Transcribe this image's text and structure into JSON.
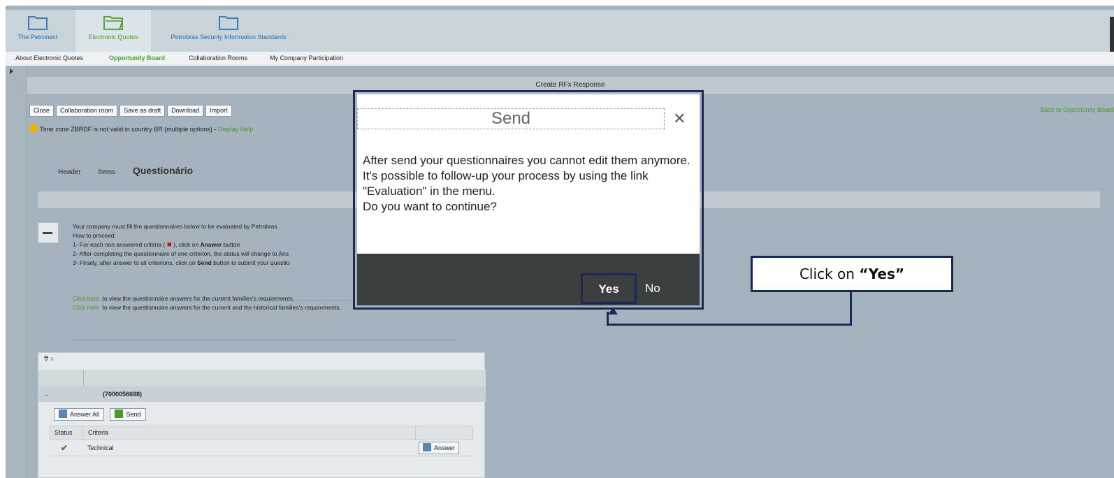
{
  "topnav": {
    "tabs": [
      {
        "label": "The Petronect",
        "active": false
      },
      {
        "label": "Electronic Quotes",
        "active": true
      },
      {
        "label": "Petrobras Security Information Standards",
        "active": false
      }
    ]
  },
  "subnav": {
    "items": [
      {
        "label": "About Electronic Quotes",
        "active": false
      },
      {
        "label": "Opportunity Board",
        "active": true
      },
      {
        "label": "Collaboration Rooms",
        "active": false
      },
      {
        "label": "My Company Participation",
        "active": false
      }
    ]
  },
  "page": {
    "title": "Create RFx Response",
    "toolbar": [
      "Close",
      "Collaboration room",
      "Save as draft",
      "Download",
      "Import"
    ],
    "back_link": "Back to Opportunity Board",
    "warning_text": "Time zone ZBRDF is not valid in country BR (multiple options) - ",
    "warning_link": "Display Help",
    "tabs": [
      "Header",
      "Items",
      "Questionário"
    ],
    "instructions": {
      "line1": "Your company must fill the questionnaires below to be evaluated by Petrobras.",
      "line2": "How to proceed:",
      "line3a": "1- For each non answered criteria (",
      "line3b": "), click on",
      "line3c": "Answer",
      "line3d": "button",
      "line4": "2- After completing the questionnaire of one criterion, the status will change to Ans",
      "line5a": "3- Finally, after answer to all criterions, click on",
      "line5b": "Send",
      "line5c": "button to submit your questio",
      "click_here": "Click here",
      "link1_text": "to view the questionnaire answers for the current families's requirements.",
      "link2_text": "to view the questionnaire answers for the current and the historical families's requirements."
    },
    "grid": {
      "group_id": "(7000056688)",
      "answer_all": "Answer All",
      "send": "Send",
      "col_status": "Status",
      "col_criteria": "Criteria",
      "row_criteria": "Technical",
      "row_answer": "Answer"
    }
  },
  "dialog": {
    "title": "Send",
    "line1": "After send your questionnaires you cannot edit them anymore.",
    "line2": "It's possible to follow-up your process by using the link \"Evaluation\" in the menu.",
    "line3": "Do you want to continue?",
    "yes": "Yes",
    "no": "No"
  },
  "callout": {
    "prefix": "Click on ",
    "emphasis": "“Yes”"
  }
}
